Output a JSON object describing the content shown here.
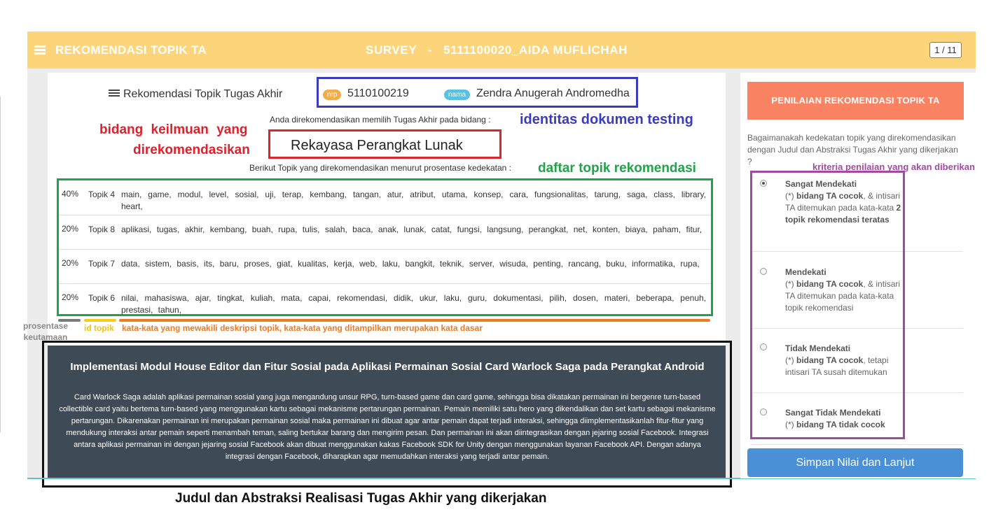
{
  "navbar": {
    "menu_icon": "hamburger-icon",
    "title": "REKOMENDASI TOPIK TA",
    "survey": "SURVEY   -   5111100020_AIDA MUFLICHAH",
    "pager": "1 / 11"
  },
  "document": {
    "title_icon": "list-icon",
    "title": "Rekomendasi Topik Tugas Akhir",
    "nrp_label": "nrp",
    "nrp_value": "5110100219",
    "nama_label": "nama",
    "nama_value": "Zendra Anugerah Andromedha",
    "anda_text": "Anda direkomendasikan memilih Tugas Akhir pada bidang :",
    "bidang": "Rekayasa Perangkat Lunak",
    "berikut_text": "Berikut Topik yang direkomendasikan menurut prosentase kedekatan :"
  },
  "topics": [
    {
      "pct": "40%",
      "topic": "Topik 4",
      "words": "main, game, modul, level, sosial, uji, terap, kembang, tangan, atur, atribut, utama, konsep, cara, fungsionalitas, tarung, saga, class, library, heart,"
    },
    {
      "pct": "20%",
      "topic": "Topik 8",
      "words": "aplikasi, tugas, akhir, kembang, buah, rupa, tulis, salah, baca, anak, lunak, catat, fungsi, langsung, perangkat, net, konten, biaya, paham, fitur,"
    },
    {
      "pct": "20%",
      "topic": "Topik 7",
      "words": "data, sistem, basis, its, baru, proses, giat, kualitas, kerja, web, laku, bangkit, teknik, server, wisuda, penting, rancang, buku, informatika, rupa,"
    },
    {
      "pct": "20%",
      "topic": "Topik 6",
      "words": "nilai, mahasiswa, ajar, tingkat, kuliah, mata, capai, rekomendasi, didik, ukur, laku, guru, dokumentasi, pilih, dosen, materi, beberapa, penuh, prestasi, tahun,"
    }
  ],
  "abstract": {
    "title": "Implementasi Modul House Editor dan Fitur Sosial pada Aplikasi Permainan Sosial Card Warlock Saga pada Perangkat Android",
    "text": "Card Warlock Saga adalah aplikasi permainan sosial yang juga mengandung unsur RPG, turn-based game dan card game, sehingga bisa dikatakan permainan ini bergenre turn-based collectible card yaitu bertema turn-based yang menggunakan kartu sebagai mekanisme pertarungan permainan. Pemain memiliki satu hero yang dikendalikan dan set kartu sebagai mekanisme pertarungan. Dikarenakan permainan ini merupakan permainan sosial maka permainan ini dibuat agar antar pemain dapat terjadi interaksi, sehingga diimplementasikanlah fitur-fitur yang mendukung interaksi antar pemain seperti menambah teman, saling bertukar barang dan mengirim pesan. Dan permainan ini akan diintegrasikan dengan jejaring sosial Facebook. Integrasi antara aplikasi permainan ini dengan jejaring sosial Facebook akan dibuat menggunakan kakas Facebook SDK for Unity dengan menggunakan layanan Facebook API. Dengan adanya integrasi dengan Facebook, diharapkan agar memudahkan interaksi yang terjadi antar pemain."
  },
  "annotations": {
    "bidang_line1": "bidang keilmuan yang",
    "bidang_line2": "direkomendasikan",
    "identitas": "identitas dokumen testing",
    "daftar": "daftar topik rekomendasi",
    "prosentase": "prosentase keutamaan",
    "id_topik": "id topik",
    "kata": "kata-kata yang mewakili deskripsi topik, kata-kata yang ditampilkan merupakan kata dasar",
    "kriteria": "kriteria penilaian yang akan diberikan",
    "judul": "Judul dan Abstraksi Realisasi Tugas Akhir yang dikerjakan"
  },
  "annotation_colors": {
    "bidang": "#e0202a",
    "identitas": "#3b3bbf",
    "daftar": "#21a349",
    "kriteria": "#a24aa2"
  },
  "right_panel": {
    "header": "PENILAIAN REKOMENDASI TOPIK TA",
    "question": "Bagaimanakah kedekatan topik yang direkomendasikan dengan Judul dan Abstraksi Tugas Akhir yang dikerjakan ?",
    "options": [
      {
        "label": "Sangat Mendekati",
        "prefix": "(*) ",
        "bold1": "bidang TA cocok",
        "rest": ", & intisari TA ditemukan pada kata-kata ",
        "bold2": "2 topik rekomendasi teratas",
        "checked": true
      },
      {
        "label": "Mendekati",
        "prefix": "(*) ",
        "bold1": "bidang TA cocok",
        "rest": ", & intisari TA ditemukan pada kata-kata topik rekomendasi",
        "checked": false
      },
      {
        "label": "Tidak Mendekati",
        "prefix": "(*) ",
        "bold1": "bidang TA cocok",
        "rest": ", tetapi intisari TA susah ditemukan",
        "checked": false
      },
      {
        "label": "Sangat Tidak Mendekati",
        "prefix": "(*) ",
        "bold1": "bidang TA tidak cocok",
        "rest": "",
        "checked": false
      }
    ],
    "button": "Simpan Nilai dan Lanjut"
  }
}
